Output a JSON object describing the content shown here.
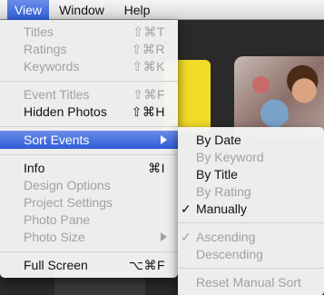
{
  "menubar": {
    "items": [
      {
        "label": "View",
        "active": true
      },
      {
        "label": "Window",
        "active": false
      },
      {
        "label": "Help",
        "active": false
      }
    ]
  },
  "view_menu": {
    "items": [
      {
        "label": "Titles",
        "shortcut": "⇧⌘T",
        "enabled": false
      },
      {
        "label": "Ratings",
        "shortcut": "⇧⌘R",
        "enabled": false
      },
      {
        "label": "Keywords",
        "shortcut": "⇧⌘K",
        "enabled": false
      },
      {
        "label": "Event Titles",
        "shortcut": "⇧⌘F",
        "enabled": false
      },
      {
        "label": "Hidden Photos",
        "shortcut": "⇧⌘H",
        "enabled": true
      },
      {
        "label": "Sort Events",
        "shortcut": "",
        "enabled": true,
        "submenu": true,
        "highlighted": true
      },
      {
        "label": "Info",
        "shortcut": "⌘I",
        "enabled": true
      },
      {
        "label": "Design Options",
        "shortcut": "",
        "enabled": false
      },
      {
        "label": "Project Settings",
        "shortcut": "",
        "enabled": false
      },
      {
        "label": "Photo Pane",
        "shortcut": "",
        "enabled": false
      },
      {
        "label": "Photo Size",
        "shortcut": "",
        "enabled": false,
        "submenu": true
      },
      {
        "label": "Full Screen",
        "shortcut": "⌥⌘F",
        "enabled": true
      }
    ]
  },
  "sort_events_submenu": {
    "items": [
      {
        "label": "By Date",
        "enabled": true,
        "checked": false
      },
      {
        "label": "By Keyword",
        "enabled": false,
        "checked": false
      },
      {
        "label": "By Title",
        "enabled": true,
        "checked": false
      },
      {
        "label": "By Rating",
        "enabled": false,
        "checked": false
      },
      {
        "label": "Manually",
        "enabled": true,
        "checked": true
      },
      {
        "label": "Ascending",
        "enabled": false,
        "checked": true
      },
      {
        "label": "Descending",
        "enabled": false,
        "checked": false
      },
      {
        "label": "Reset Manual Sort",
        "enabled": false,
        "checked": false
      }
    ],
    "check_glyph": "✓"
  },
  "colors": {
    "highlight": "#2e5bd8",
    "disabled_text": "#a1a1a1"
  }
}
